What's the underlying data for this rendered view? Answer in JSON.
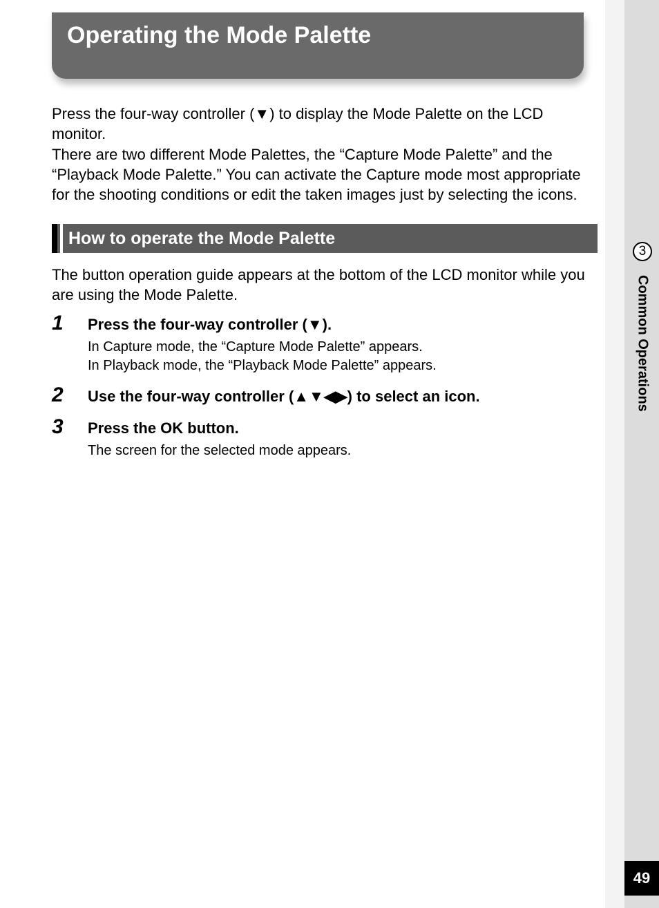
{
  "chapter": {
    "number": "3",
    "label": "Common Operations"
  },
  "page_number": "49",
  "title": "Operating the Mode Palette",
  "intro": "Press the four-way controller (▼) to display the Mode Palette on the LCD monitor.\nThere are two different Mode Palettes, the “Capture Mode Palette” and the “Playback Mode Palette.” You can activate the Capture mode most appropriate for the shooting conditions or edit the taken images just by selecting the icons.",
  "subheading": "How to operate the Mode Palette",
  "sub_intro": "The button operation guide appears at the bottom of the LCD monitor while you are using the Mode Palette.",
  "steps": [
    {
      "n": "1",
      "title": "Press the four-way controller (▼).",
      "detail": "In Capture mode, the “Capture Mode Palette” appears.\nIn Playback mode, the “Playback Mode Palette” appears."
    },
    {
      "n": "2",
      "title": "Use the four-way controller (▲▼◀▶) to select an icon.",
      "detail": ""
    },
    {
      "n": "3",
      "title": "Press the OK button.",
      "detail": "The screen for the selected mode appears."
    }
  ]
}
